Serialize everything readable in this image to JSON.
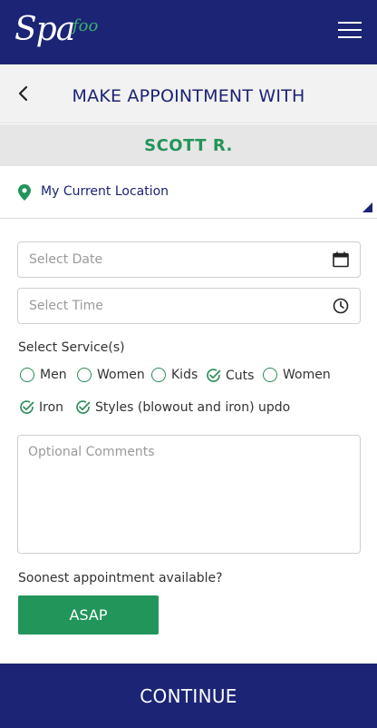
{
  "header": {
    "logo": {
      "main": "Spa",
      "suffix": "foo"
    },
    "menu_icon": "hamburger-menu-icon"
  },
  "title_bar": {
    "back_icon": "chevron-left-icon",
    "title": "MAKE APPOINTMENT WITH"
  },
  "provider": {
    "name": "SCOTT R."
  },
  "location": {
    "icon": "location-pin-icon",
    "label": "My Current Location"
  },
  "form": {
    "date_placeholder": "Select Date",
    "date_icon": "calendar-icon",
    "time_placeholder": "Select Time",
    "time_icon": "clock-icon",
    "services_label": "Select Service(s)",
    "services": [
      {
        "label": "Men",
        "selected": false
      },
      {
        "label": "Women",
        "selected": false
      },
      {
        "label": "Kids",
        "selected": false
      },
      {
        "label": "Cuts",
        "selected": true
      },
      {
        "label": "Women",
        "selected": false
      },
      {
        "label": "Iron",
        "selected": true
      },
      {
        "label": "Styles (blowout and iron) updo",
        "selected": true
      }
    ],
    "comments_placeholder": "Optional Comments",
    "soonest_label": "Soonest appointment available?",
    "asap_label": "ASAP"
  },
  "footer": {
    "continue_label": "CONTINUE"
  },
  "colors": {
    "navy": "#1b2475",
    "green": "#22955a",
    "light_gray": "#f2f2f2"
  }
}
